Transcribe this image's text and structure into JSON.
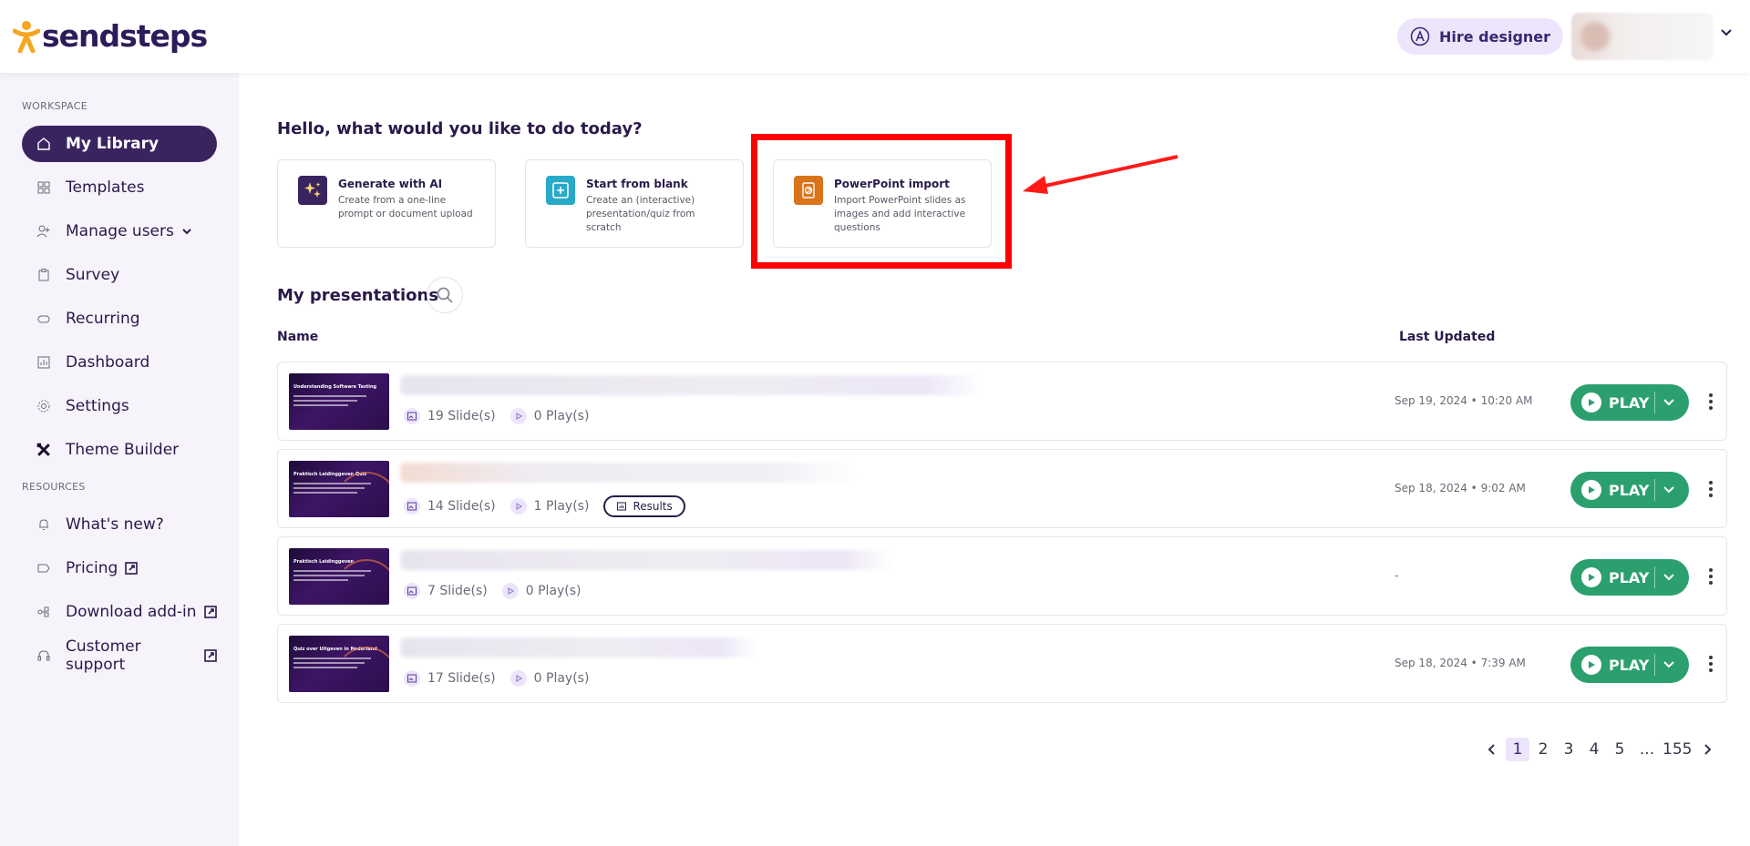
{
  "app": {
    "brand": "sendsteps",
    "accent": "#3a2460",
    "play_color": "#2ba06e",
    "highlight_color": "#ff0000"
  },
  "header": {
    "hire_label": "Hire designer",
    "hire_icon": "designer-icon"
  },
  "sidebar": {
    "workspace_label": "WORKSPACE",
    "resources_label": "RESOURCES",
    "workspace_items": [
      {
        "label": "My Library",
        "icon": "home-icon",
        "active": true
      },
      {
        "label": "Templates",
        "icon": "grid-icon"
      },
      {
        "label": "Manage users",
        "icon": "add-user-icon",
        "dropdown": true
      },
      {
        "label": "Survey",
        "icon": "clipboard-icon"
      },
      {
        "label": "Recurring",
        "icon": "recurring-icon"
      },
      {
        "label": "Dashboard",
        "icon": "chart-icon"
      },
      {
        "label": "Settings",
        "icon": "gear-icon"
      },
      {
        "label": "Theme Builder",
        "icon": "tools-icon"
      }
    ],
    "resource_items": [
      {
        "label": "What's new?",
        "icon": "bell-icon"
      },
      {
        "label": "Pricing",
        "icon": "tag-icon",
        "external": true
      },
      {
        "label": "Download add-in",
        "icon": "addin-icon",
        "external": true
      },
      {
        "label": "Customer support",
        "icon": "headset-icon",
        "external": true
      }
    ]
  },
  "main": {
    "greeting": "Hello, what would you like to do today?",
    "cards": [
      {
        "title": "Generate with AI",
        "desc": "Create from a one-line prompt or document upload",
        "icon": "sparkles-icon",
        "icon_bg": "#3a2460"
      },
      {
        "title": "Start from blank",
        "desc": "Create an (interactive) presentation/quiz from scratch",
        "icon": "plus-square-icon",
        "icon_bg": "#29a9c9"
      },
      {
        "title": "PowerPoint import",
        "desc": "Import PowerPoint slides as images and add interactive questions",
        "icon": "powerpoint-icon",
        "icon_bg": "#d9741a"
      }
    ],
    "section_title": "My presentations",
    "columns": {
      "name": "Name",
      "updated": "Last Updated"
    },
    "play_label": "PLAY",
    "results_label": "Results",
    "rows": [
      {
        "thumb_title": "Understanding Software Testing",
        "slides": "19 Slide(s)",
        "plays": "0 Play(s)",
        "updated": "Sep 19, 2024 • 10:20 AM",
        "has_results": false
      },
      {
        "thumb_title": "Praktisch Leidinggeven Quiz",
        "slides": "14 Slide(s)",
        "plays": "1 Play(s)",
        "updated": "Sep 18, 2024 • 9:02 AM",
        "has_results": true
      },
      {
        "thumb_title": "Praktisch Leidinggeven",
        "slides": "7 Slide(s)",
        "plays": "0 Play(s)",
        "updated": "-",
        "has_results": false
      },
      {
        "thumb_title": "Quiz over Uitgeven in Nederland",
        "slides": "17 Slide(s)",
        "plays": "0 Play(s)",
        "updated": "Sep 18, 2024 • 7:39 AM",
        "has_results": false
      }
    ],
    "pagination": {
      "pages": [
        "1",
        "2",
        "3",
        "4",
        "5"
      ],
      "ellipsis": "...",
      "last": "155",
      "current": "1"
    }
  }
}
